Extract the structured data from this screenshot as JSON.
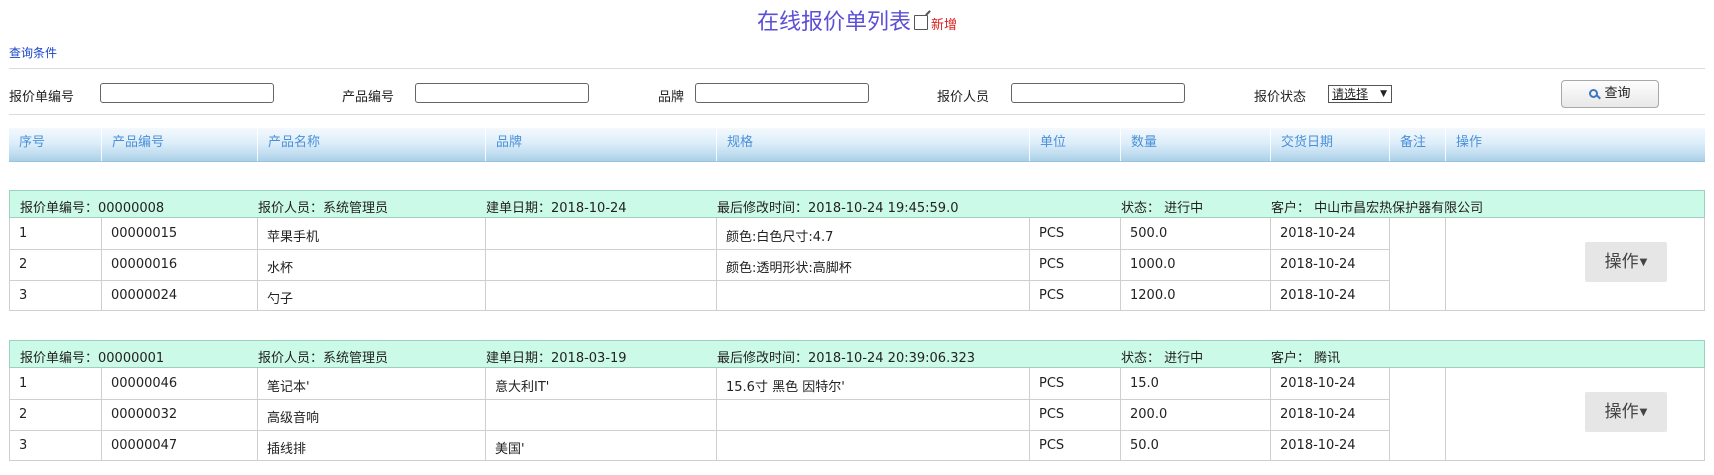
{
  "title": "在线报价单列表",
  "new_label": "新增",
  "query_toggle": "查询条件",
  "search": {
    "fields": [
      {
        "label": "报价单编号",
        "value": ""
      },
      {
        "label": "产品编号",
        "value": ""
      },
      {
        "label": "品牌",
        "value": ""
      },
      {
        "label": "报价人员",
        "value": ""
      }
    ],
    "status_label": "报价状态",
    "status_value": "请选择",
    "search_button": "查询"
  },
  "columns": [
    "序号",
    "产品编号",
    "产品名称",
    "品牌",
    "规格",
    "单位",
    "数量",
    "交货日期",
    "备注",
    "操作"
  ],
  "orders": [
    {
      "header": {
        "order_no": "报价单编号：00000008",
        "staff": "报价人员：系统管理员",
        "created": "建单日期：2018-10-24",
        "modified": "最后修改时间：2018-10-24 19:45:59.0",
        "status": "状态：  进行中",
        "customer": "客户：  中山市昌宏热保护器有限公司"
      },
      "rows": [
        {
          "seq": "1",
          "product_no": "00000015",
          "name": "苹果手机",
          "brand": "",
          "spec": "颜色:白色尺寸:4.7",
          "unit": "PCS",
          "qty": "500.0",
          "date": "2018-10-24"
        },
        {
          "seq": "2",
          "product_no": "00000016",
          "name": "水杯",
          "brand": "",
          "spec": "颜色:透明形状:高脚杯",
          "unit": "PCS",
          "qty": "1000.0",
          "date": "2018-10-24"
        },
        {
          "seq": "3",
          "product_no": "00000024",
          "name": "勺子",
          "brand": "",
          "spec": "",
          "unit": "PCS",
          "qty": "1200.0",
          "date": "2018-10-24"
        }
      ],
      "op_label": "操作"
    },
    {
      "header": {
        "order_no": "报价单编号：00000001",
        "staff": "报价人员：系统管理员",
        "created": "建单日期：2018-03-19",
        "modified": "最后修改时间：2018-10-24 20:39:06.323",
        "status": "状态：  进行中",
        "customer": "客户：  腾讯"
      },
      "rows": [
        {
          "seq": "1",
          "product_no": "00000046",
          "name": "笔记本'",
          "brand": "意大利IT'",
          "spec": "15.6寸 黑色 因特尔'",
          "unit": "PCS",
          "qty": "15.0",
          "date": "2018-10-24"
        },
        {
          "seq": "2",
          "product_no": "00000032",
          "name": "高级音响",
          "brand": "",
          "spec": "",
          "unit": "PCS",
          "qty": "200.0",
          "date": "2018-10-24"
        },
        {
          "seq": "3",
          "product_no": "00000047",
          "name": "插线排",
          "brand": "美国'",
          "spec": "",
          "unit": "PCS",
          "qty": "50.0",
          "date": "2018-10-24"
        }
      ],
      "op_label": "操作"
    }
  ]
}
